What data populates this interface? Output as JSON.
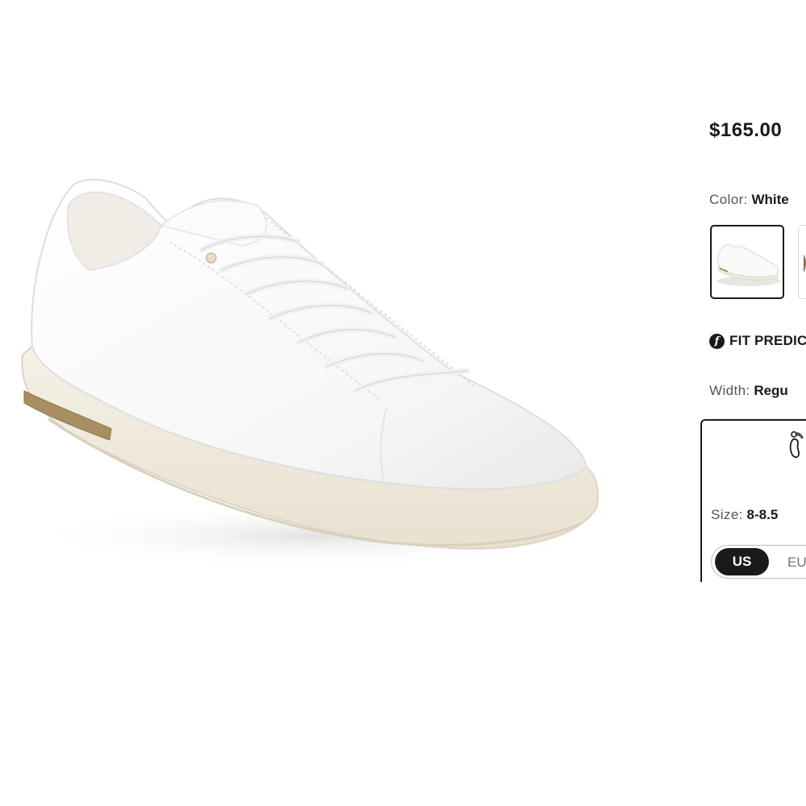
{
  "product": {
    "price": "$165.00",
    "color_label": "Color:",
    "color_value": "White",
    "swatches": [
      {
        "name": "White",
        "selected": true
      },
      {
        "name": "Other",
        "selected": false
      }
    ],
    "fit_predictor_label": "FIT PREDIC",
    "width_label": "Width:",
    "width_value": "Regu",
    "size_label": "Size:",
    "size_value": "8-8.5",
    "size_units": {
      "selected": "US",
      "other": "EU"
    }
  },
  "icons": {
    "fit_logo": "fit-predictor-logo-icon",
    "foot": "foot-icon"
  },
  "colors": {
    "selected_border": "#1a1a1a",
    "toggle_active_bg": "#1a1a1a",
    "sole": "#efe9dc",
    "cork": "#a88e63"
  }
}
